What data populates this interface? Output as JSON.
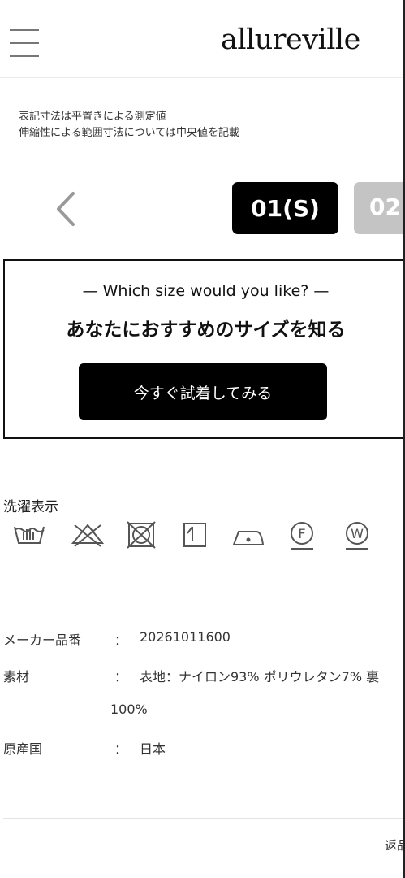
{
  "header": {
    "logo": "allureville",
    "menu_icon": "hamburger-menu-icon"
  },
  "size_note": {
    "line1": "表記寸法は平置きによる測定値",
    "line2": "伸縮性による範囲寸法については中央値を記載"
  },
  "size_tabs": {
    "prev_icon": "chevron-left-icon",
    "active": "01(S)",
    "next": "02"
  },
  "fit_promo": {
    "heading_en": "— Which size would you like? —",
    "heading_jp": "あなたにおすすめのサイズを知る",
    "button_label": "今すぐ試着してみる"
  },
  "care": {
    "title": "洗濯表示",
    "icons": [
      "hand-wash-icon",
      "no-bleach-icon",
      "no-tumble-dry-icon",
      "line-dry-icon",
      "iron-low-icon",
      "dry-clean-f-icon",
      "wet-clean-w-icon"
    ],
    "letters": {
      "dry_clean": "F",
      "wet_clean": "W"
    }
  },
  "specs": {
    "colon": "：",
    "maker_label": "メーカー品番",
    "maker_value": "20261011600",
    "material_label": "素材",
    "material_value": "表地：ナイロン93% ポリウレタン7% 裏",
    "material_value_cont": "100%",
    "origin_label": "原産国",
    "origin_value": "日本"
  },
  "footer": {
    "link": "返品"
  },
  "colors": {
    "button_bg": "#000000",
    "tab_inactive": "#c4c4c4",
    "icon_stroke": "#555555"
  }
}
